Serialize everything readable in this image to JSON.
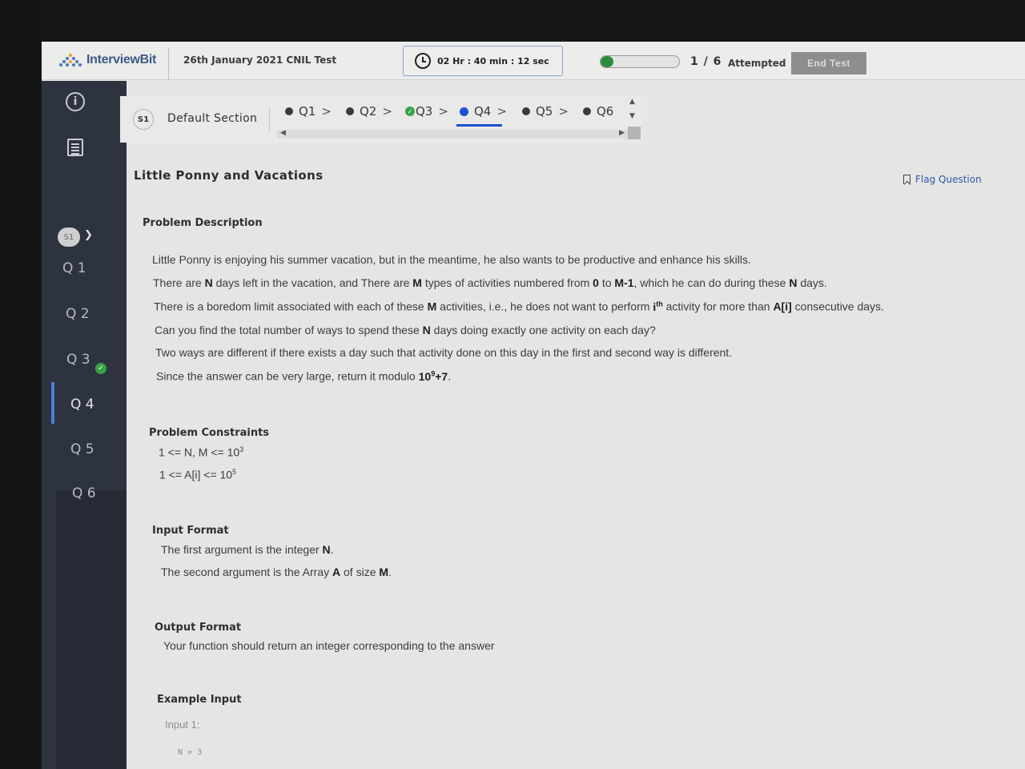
{
  "header": {
    "logo_text": "InterviewBit",
    "test_title": "26th January 2021 CNIL Test",
    "timer": "02 Hr : 40 min : 12 sec",
    "progress_fraction": 0.1667,
    "attempt_count": "1 / 6",
    "attempt_label": "Attempted",
    "end_test_label": "End Test"
  },
  "sidebar": {
    "section_badge": "S1",
    "questions": [
      "Q 1",
      "Q 2",
      "Q 3",
      "Q 4",
      "Q 5",
      "Q 6"
    ]
  },
  "qnav": {
    "section_badge": "S1",
    "section_name": "Default Section",
    "tabs": [
      "Q1",
      "Q2",
      "Q3",
      "Q4",
      "Q5",
      "Q6"
    ],
    "active_tab": "Q4",
    "attempted_tab": "Q3"
  },
  "question": {
    "title": "Little Ponny and Vacations",
    "flag_label": "Flag Question",
    "desc_heading": "Problem Description",
    "constraints_heading": "Problem Constraints",
    "input_heading": "Input Format",
    "output_heading": "Output Format",
    "output_text": "Your function should return an integer corresponding to the answer",
    "example_heading": "Example Input",
    "example_input_label": "Input 1:",
    "example_line": "N = 3"
  },
  "colors": {
    "sidebar": "#2e3340",
    "accent_blue": "#1f4fd1",
    "attempted_green": "#37a347",
    "link_blue": "#2f5aa8"
  }
}
